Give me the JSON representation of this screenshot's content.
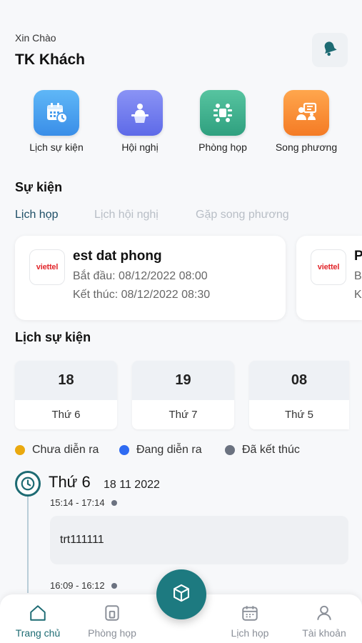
{
  "header": {
    "greeting": "Xin Chào",
    "user_name": "TK Khách"
  },
  "shortcuts": [
    {
      "label": "Lịch sự kiện",
      "icon": "calendar-clock-icon",
      "color": "#4aa3f0"
    },
    {
      "label": "Hội nghị",
      "icon": "podium-speaker-icon",
      "color": "#6b78f0"
    },
    {
      "label": "Phòng họp",
      "icon": "meeting-table-icon",
      "color": "#3fb08f"
    },
    {
      "label": "Song phương",
      "icon": "bilateral-talk-icon",
      "color": "#f7913a"
    }
  ],
  "events": {
    "title": "Sự kiện",
    "tabs": [
      "Lịch họp",
      "Lịch hội nghị",
      "Gặp song phương"
    ],
    "active_tab": 0,
    "cards": [
      {
        "logo": "viettel",
        "title": "est dat phong",
        "start": "Bắt đầu: 08/12/2022 08:00",
        "end": "Kết thúc: 08/12/2022 08:30"
      },
      {
        "logo": "viettel",
        "title": "P",
        "start": "B",
        "end": "K"
      }
    ]
  },
  "schedule": {
    "title": "Lịch sự kiện",
    "days": [
      {
        "num": "18",
        "weekday": "Thứ 6"
      },
      {
        "num": "19",
        "weekday": "Thứ 7"
      },
      {
        "num": "08",
        "weekday": "Thứ 5"
      }
    ],
    "legend": [
      {
        "label": "Chưa diễn ra",
        "color": "#eaa90f"
      },
      {
        "label": "Đang diễn ra",
        "color": "#2f6bf2"
      },
      {
        "label": "Đã kết thúc",
        "color": "#6b7280"
      }
    ],
    "timeline": {
      "day": "Thứ 6",
      "date": "18 11 2022",
      "items": [
        {
          "time": "15:14 - 17:14",
          "title": "trt111111"
        },
        {
          "time": "16:09 - 16:12"
        }
      ]
    }
  },
  "nav": {
    "items": [
      {
        "label": "Trang chủ",
        "icon": "home-icon"
      },
      {
        "label": "Phòng họp",
        "icon": "door-icon"
      },
      {
        "label": "Lịch họp",
        "icon": "calendar-icon"
      },
      {
        "label": "Tài khoản",
        "icon": "user-icon"
      }
    ],
    "active": 0,
    "fab_icon": "cube-icon",
    "accent": "#1d6b73"
  }
}
